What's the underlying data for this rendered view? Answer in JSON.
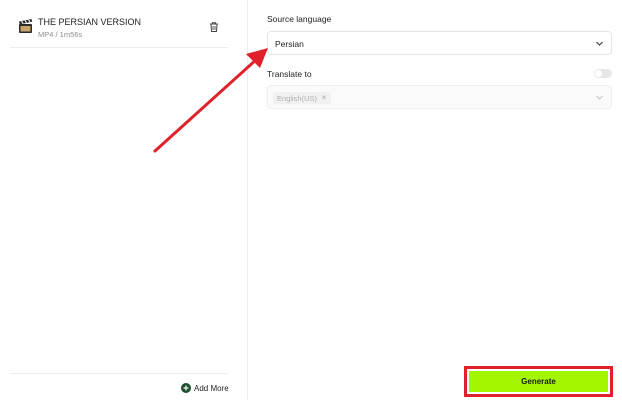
{
  "file": {
    "title": "THE PERSIAN VERSION",
    "meta": "MP4 / 1m56s",
    "icon": "clapperboard-icon"
  },
  "left_footer": {
    "add_more_label": "Add More",
    "add_icon": "plus-circle-icon"
  },
  "source_language": {
    "label": "Source language",
    "value": "Persian"
  },
  "translate_to": {
    "label": "Translate to",
    "enabled": false,
    "tags": [
      "English(US)"
    ]
  },
  "generate": {
    "label": "Generate"
  },
  "colors": {
    "accent": "#a3f500",
    "annotation": "#e0212b"
  }
}
